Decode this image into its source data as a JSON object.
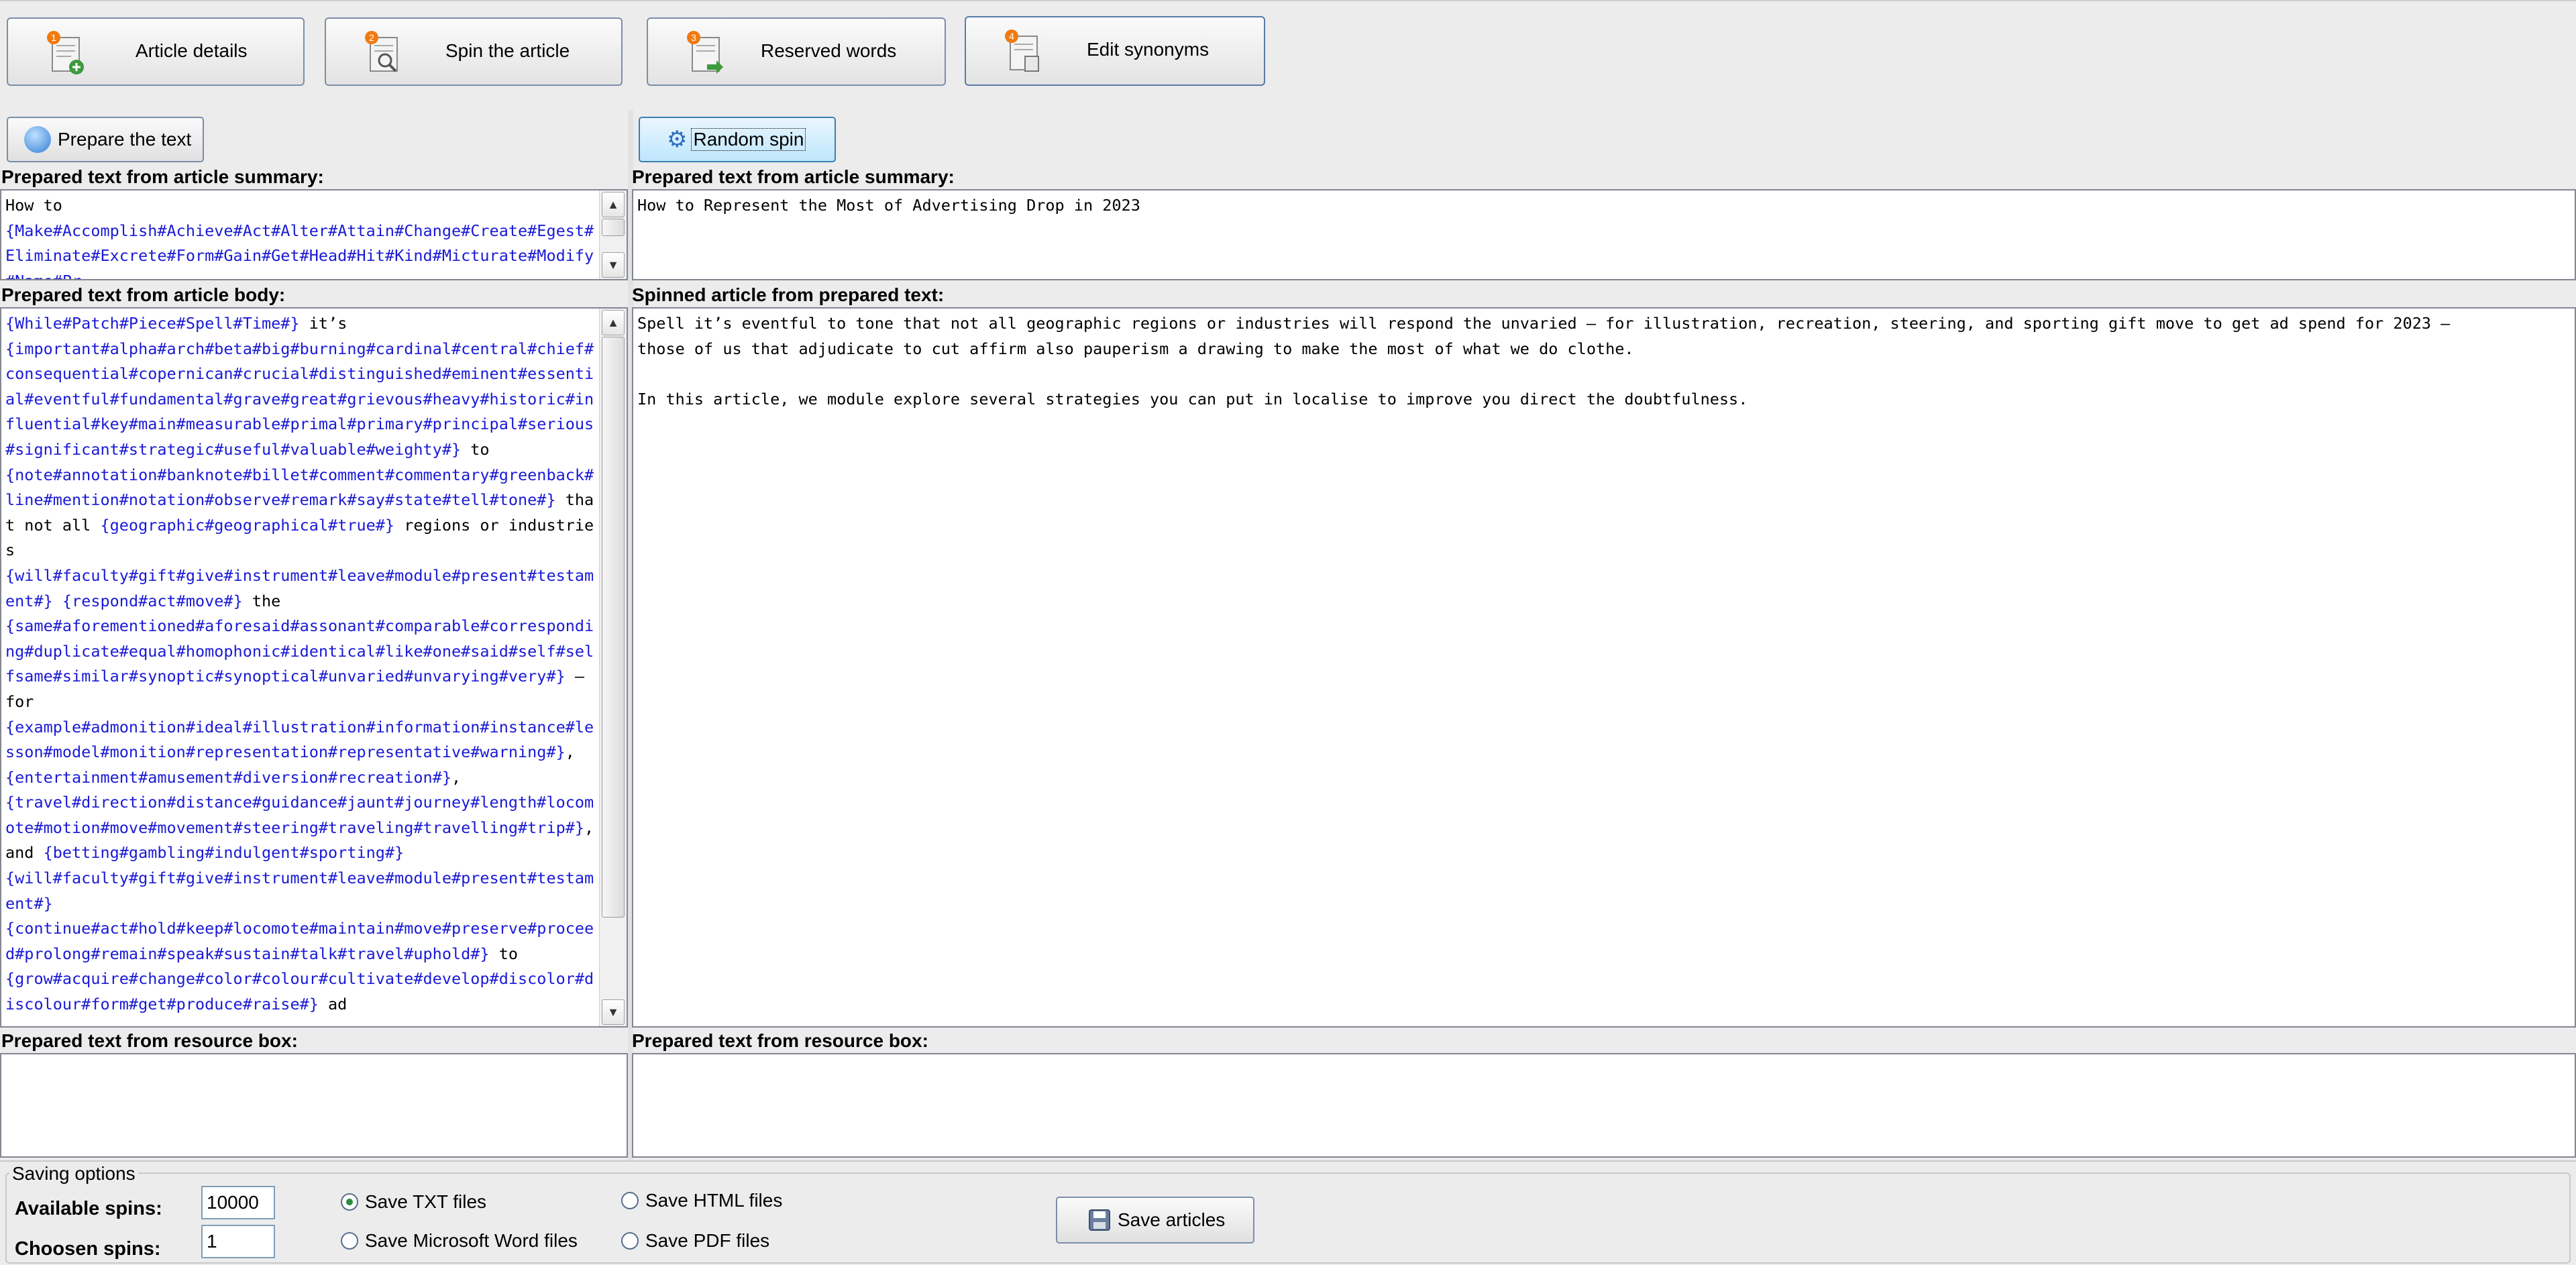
{
  "tabs": [
    {
      "label": "Article details",
      "step": "1"
    },
    {
      "label": "Spin the article",
      "step": "2"
    },
    {
      "label": "Reserved words",
      "step": "3"
    },
    {
      "label": "Edit synonyms",
      "step": "4"
    }
  ],
  "left": {
    "prepare_button": "Prepare the text",
    "summary_heading": "Prepared text from article summary:",
    "summary_lines": [
      "How to",
      "{Make#Accomplish#Achieve#Act#Alter#Attain#Change#Create#Eg",
      "est#Eliminate#Excrete#Form#Gain#Get#Head#Hit#Kind#Micturat",
      "e#Modify#Name#Pr"
    ],
    "body_heading": "Prepared text from article body:",
    "body_segments": [
      {
        "t": "{While#Patch#Piece#Spell#Time#}",
        "s": true
      },
      {
        "t": " it’s\n",
        "s": false
      },
      {
        "t": "{important#alpha#arch#beta#big#burning#cardinal#central#chief#consequential#copernican#crucial#distinguished#eminent#essential#eventful#fundamental#grave#great#grievous#heavy#historic#influential#key#main#measurable#primal#primary#principal#serious#significant#strategic#useful#valuable#weighty#}",
        "s": true
      },
      {
        "t": " to\n",
        "s": false
      },
      {
        "t": "{note#annotation#banknote#billet#comment#commentary#greenback#line#mention#notation#observe#remark#say#state#tell#tone#}",
        "s": true
      },
      {
        "t": " that not all ",
        "s": false
      },
      {
        "t": "{geographic#geographical#true#}",
        "s": true
      },
      {
        "t": " regions or industries\n",
        "s": false
      },
      {
        "t": "{will#faculty#gift#give#instrument#leave#module#present#testament#}",
        "s": true
      },
      {
        "t": " ",
        "s": false
      },
      {
        "t": "{respond#act#move#}",
        "s": true
      },
      {
        "t": " the\n",
        "s": false
      },
      {
        "t": "{same#aforementioned#aforesaid#assonant#comparable#corresponding#duplicate#equal#homophonic#identical#like#one#said#self#selfsame#similar#synoptic#synoptical#unvaried#unvarying#very#}",
        "s": true
      },
      {
        "t": " – for\n",
        "s": false
      },
      {
        "t": "{example#admonition#ideal#illustration#information#instance#lesson#model#monition#representation#representative#warning#}",
        "s": true
      },
      {
        "t": ", ",
        "s": false
      },
      {
        "t": "{entertainment#amusement#diversion#recreation#}",
        "s": true
      },
      {
        "t": ",\n",
        "s": false
      },
      {
        "t": "{travel#direction#distance#guidance#jaunt#journey#length#locomote#motion#move#movement#steering#traveling#travelling#trip#}",
        "s": true
      },
      {
        "t": ", and ",
        "s": false
      },
      {
        "t": "{betting#gambling#indulgent#sporting#}",
        "s": true
      },
      {
        "t": "\n",
        "s": false
      },
      {
        "t": "{will#faculty#gift#give#instrument#leave#module#present#testament#}",
        "s": true
      },
      {
        "t": "\n",
        "s": false
      },
      {
        "t": "{continue#act#hold#keep#locomote#maintain#move#preserve#proceed#prolong#remain#speak#sustain#talk#travel#uphold#}",
        "s": true
      },
      {
        "t": " to\n",
        "s": false
      },
      {
        "t": "{grow#acquire#change#color#colour#cultivate#develop#discolor#discolour#form#get#produce#raise#}",
        "s": true
      },
      {
        "t": " ad",
        "s": false
      }
    ],
    "resource_heading": "Prepared text from resource box:"
  },
  "right": {
    "random_button": "Random spin",
    "summary_heading": "Prepared text from article summary:",
    "summary_text": "How to Represent the Most of Advertising Drop in 2023",
    "spinned_heading": "Spinned article from prepared text:",
    "spinned_lines": [
      "Spell it’s eventful to tone that not all geographic regions or industries will respond the unvaried – for illustration, recreation, steering, and sporting gift move to get ad spend for 2023 –",
      "those of us that adjudicate to cut affirm also pauperism a drawing to make the most of what we do clothe.",
      "",
      "In this article, we module explore several strategies you can put in localise to improve you direct the doubtfulness."
    ],
    "resource_heading": "Prepared text from resource box:"
  },
  "saving": {
    "group_label": "Saving options",
    "available_label": "Available spins:",
    "available_value": "10000",
    "chosen_label": "Choosen spins:",
    "chosen_value": "1",
    "opt_txt": "Save TXT files",
    "opt_word": "Save Microsoft Word files",
    "opt_html": "Save HTML files",
    "opt_pdf": "Save PDF files",
    "save_button": "Save articles"
  },
  "colors": {
    "synonym": "#1a1ad6",
    "badge": "#f07a10"
  }
}
